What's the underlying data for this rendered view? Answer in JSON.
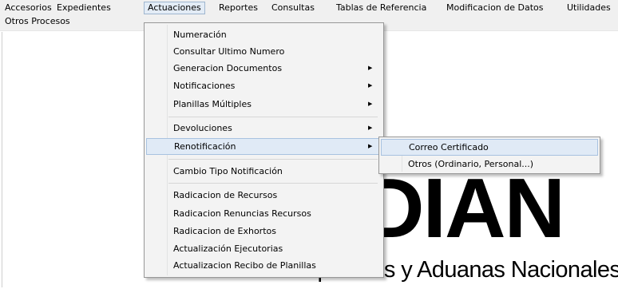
{
  "menubar": {
    "items": [
      {
        "label": "Accesorios"
      },
      {
        "label": "Expedientes"
      },
      {
        "label": "Actuaciones"
      },
      {
        "label": "Reportes"
      },
      {
        "label": "Consultas"
      },
      {
        "label": "Tablas de Referencia"
      },
      {
        "label": "Modificacion de Datos"
      },
      {
        "label": "Utilidades"
      },
      {
        "label": "Otros Procesos"
      }
    ],
    "active": "Actuaciones"
  },
  "actuaciones_menu": {
    "items": [
      {
        "label": "Numeración",
        "submenu": false
      },
      {
        "label": "Consultar Ultimo Numero",
        "submenu": false
      },
      {
        "label": "Generacion Documentos",
        "submenu": true
      },
      {
        "label": "Notificaciones",
        "submenu": true
      },
      {
        "label": "Planillas Múltiples",
        "submenu": true
      },
      {
        "label": "Devoluciones",
        "submenu": true
      },
      {
        "label": "Renotificación",
        "submenu": true,
        "highlighted": true
      },
      {
        "label": "Cambio Tipo Notificación",
        "submenu": false
      },
      {
        "label": "Radicacion de Recursos",
        "submenu": false
      },
      {
        "label": "Radicacion Renuncias Recursos",
        "submenu": false
      },
      {
        "label": "Radicacion de Exhortos",
        "submenu": false
      },
      {
        "label": "Actualización Ejecutorias",
        "submenu": false
      },
      {
        "label": "Actualizacion Recibo de Planillas",
        "submenu": false
      }
    ]
  },
  "renotificacion_submenu": {
    "items": [
      {
        "label": "Correo Certificado",
        "highlighted": true
      },
      {
        "label": "Otros (Ordinario, Personal...)"
      }
    ]
  },
  "background": {
    "logo_text": "DIAN",
    "subtitle": "Dirección de Impuestos y Aduanas Nacionales"
  },
  "colors": {
    "menubar_bg": "#f0f0f0",
    "menu_bg": "#f3f3f3",
    "highlight_bg": "#e0eaf6",
    "highlight_border": "#a8c2e0"
  }
}
